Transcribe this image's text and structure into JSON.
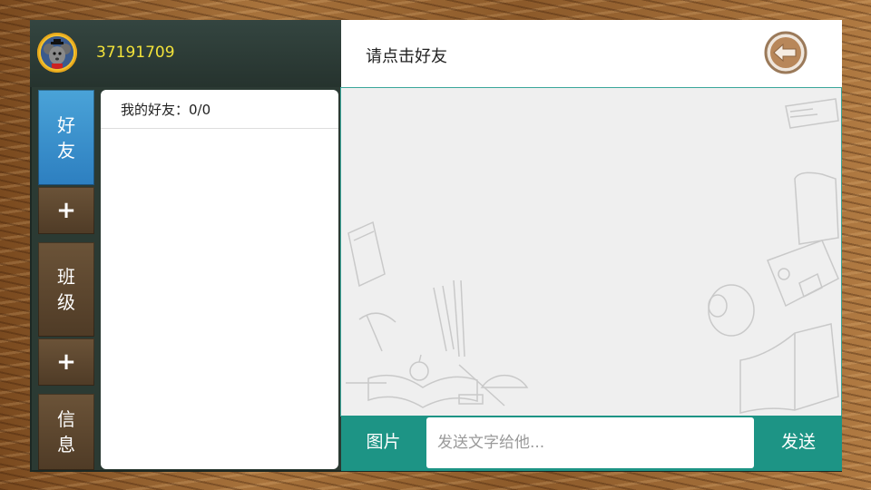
{
  "header": {
    "user_id": "37191709",
    "title": "请点击好友"
  },
  "sidebar": {
    "items": [
      {
        "label": "好友",
        "active": true
      },
      {
        "label": "+"
      },
      {
        "label": "班级"
      },
      {
        "label": "+"
      },
      {
        "label": "信息"
      }
    ]
  },
  "friends": {
    "header": "我的好友：0/0"
  },
  "composer": {
    "image_label": "图片",
    "placeholder": "发送文字给他...",
    "send_label": "发送"
  },
  "colors": {
    "accent_teal": "#1d9485",
    "active_blue": "#3a92cf",
    "user_id_yellow": "#f2e23a",
    "board_dark": "#2b3a33"
  }
}
